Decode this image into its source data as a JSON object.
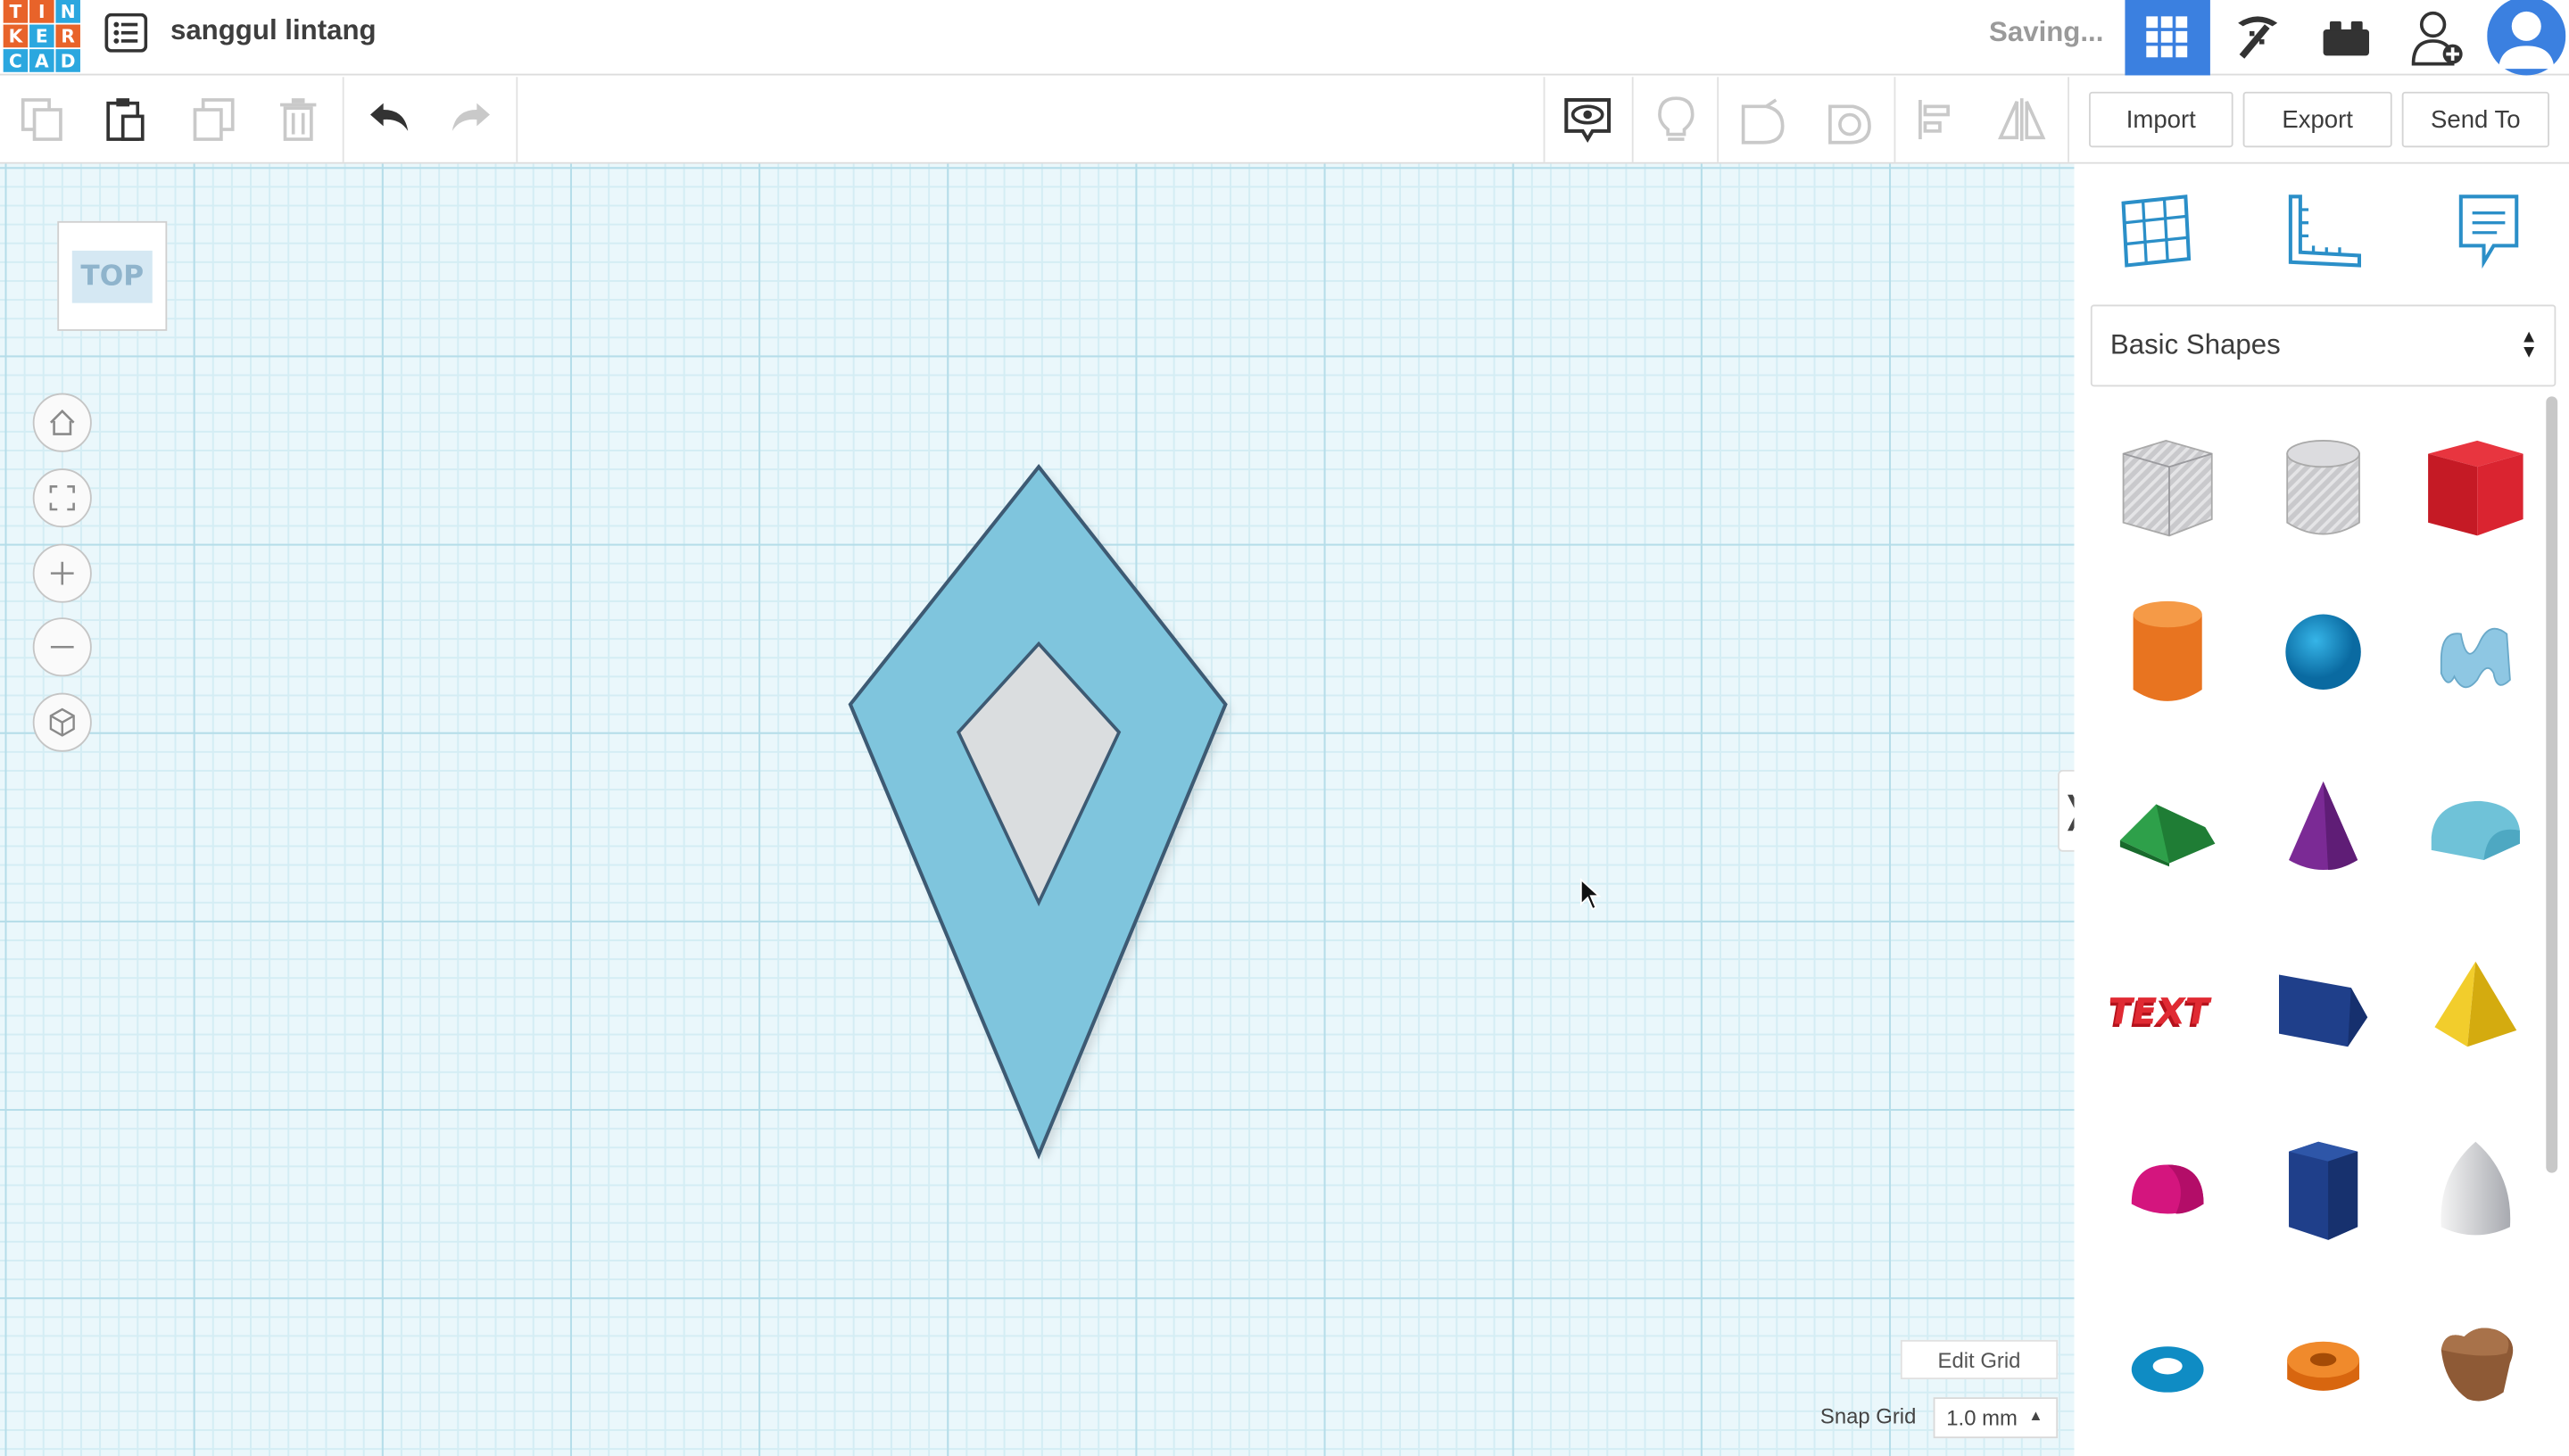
{
  "header": {
    "logo_letters": [
      "T",
      "I",
      "N",
      "K",
      "E",
      "R",
      "C",
      "A",
      "D"
    ],
    "logo_colors": [
      "#e8632a",
      "#e8632a",
      "#2ba7df",
      "#e8632a",
      "#2ba7df",
      "#e8632a",
      "#2ba7df",
      "#2ba7df",
      "#2ba7df"
    ],
    "design_title": "sanggul lintang",
    "status": "Saving...",
    "icons": [
      "menu-icon",
      "grid-view-icon",
      "pickaxe-icon",
      "bricks-icon",
      "add-user-icon",
      "avatar-icon"
    ]
  },
  "toolbar": {
    "tools": [
      "copy-icon",
      "paste-icon",
      "duplicate-icon",
      "delete-icon",
      "undo-icon",
      "redo-icon",
      "notes-visibility-icon",
      "light-icon",
      "solid-icon",
      "hole-icon",
      "align-icon",
      "mirror-icon"
    ],
    "import_label": "Import",
    "export_label": "Export",
    "sendto_label": "Send To"
  },
  "workplane": {
    "viewcube_label": "TOP",
    "nav_icons": [
      "home-view-icon",
      "fit-view-icon",
      "zoom-in-icon",
      "zoom-out-icon",
      "perspective-icon"
    ],
    "collapse_label": "❭",
    "edit_grid_label": "Edit Grid",
    "snap_grid_label": "Snap Grid",
    "snap_grid_value": "1.0 mm",
    "shape_fill": "#7fc5dd",
    "hole_fill": "#dadddf",
    "outline": "#3d5a73"
  },
  "panel": {
    "tools": [
      "workplane-icon",
      "ruler-icon",
      "notes-icon"
    ],
    "library_select": "Basic Shapes",
    "shapes": [
      "box-hole",
      "cylinder-hole",
      "box",
      "cylinder",
      "sphere",
      "scribble",
      "roof",
      "cone",
      "round-roof",
      "text",
      "wedge",
      "pyramid",
      "half-sphere",
      "polygon",
      "paraboloid",
      "torus",
      "tube",
      "heart"
    ]
  }
}
